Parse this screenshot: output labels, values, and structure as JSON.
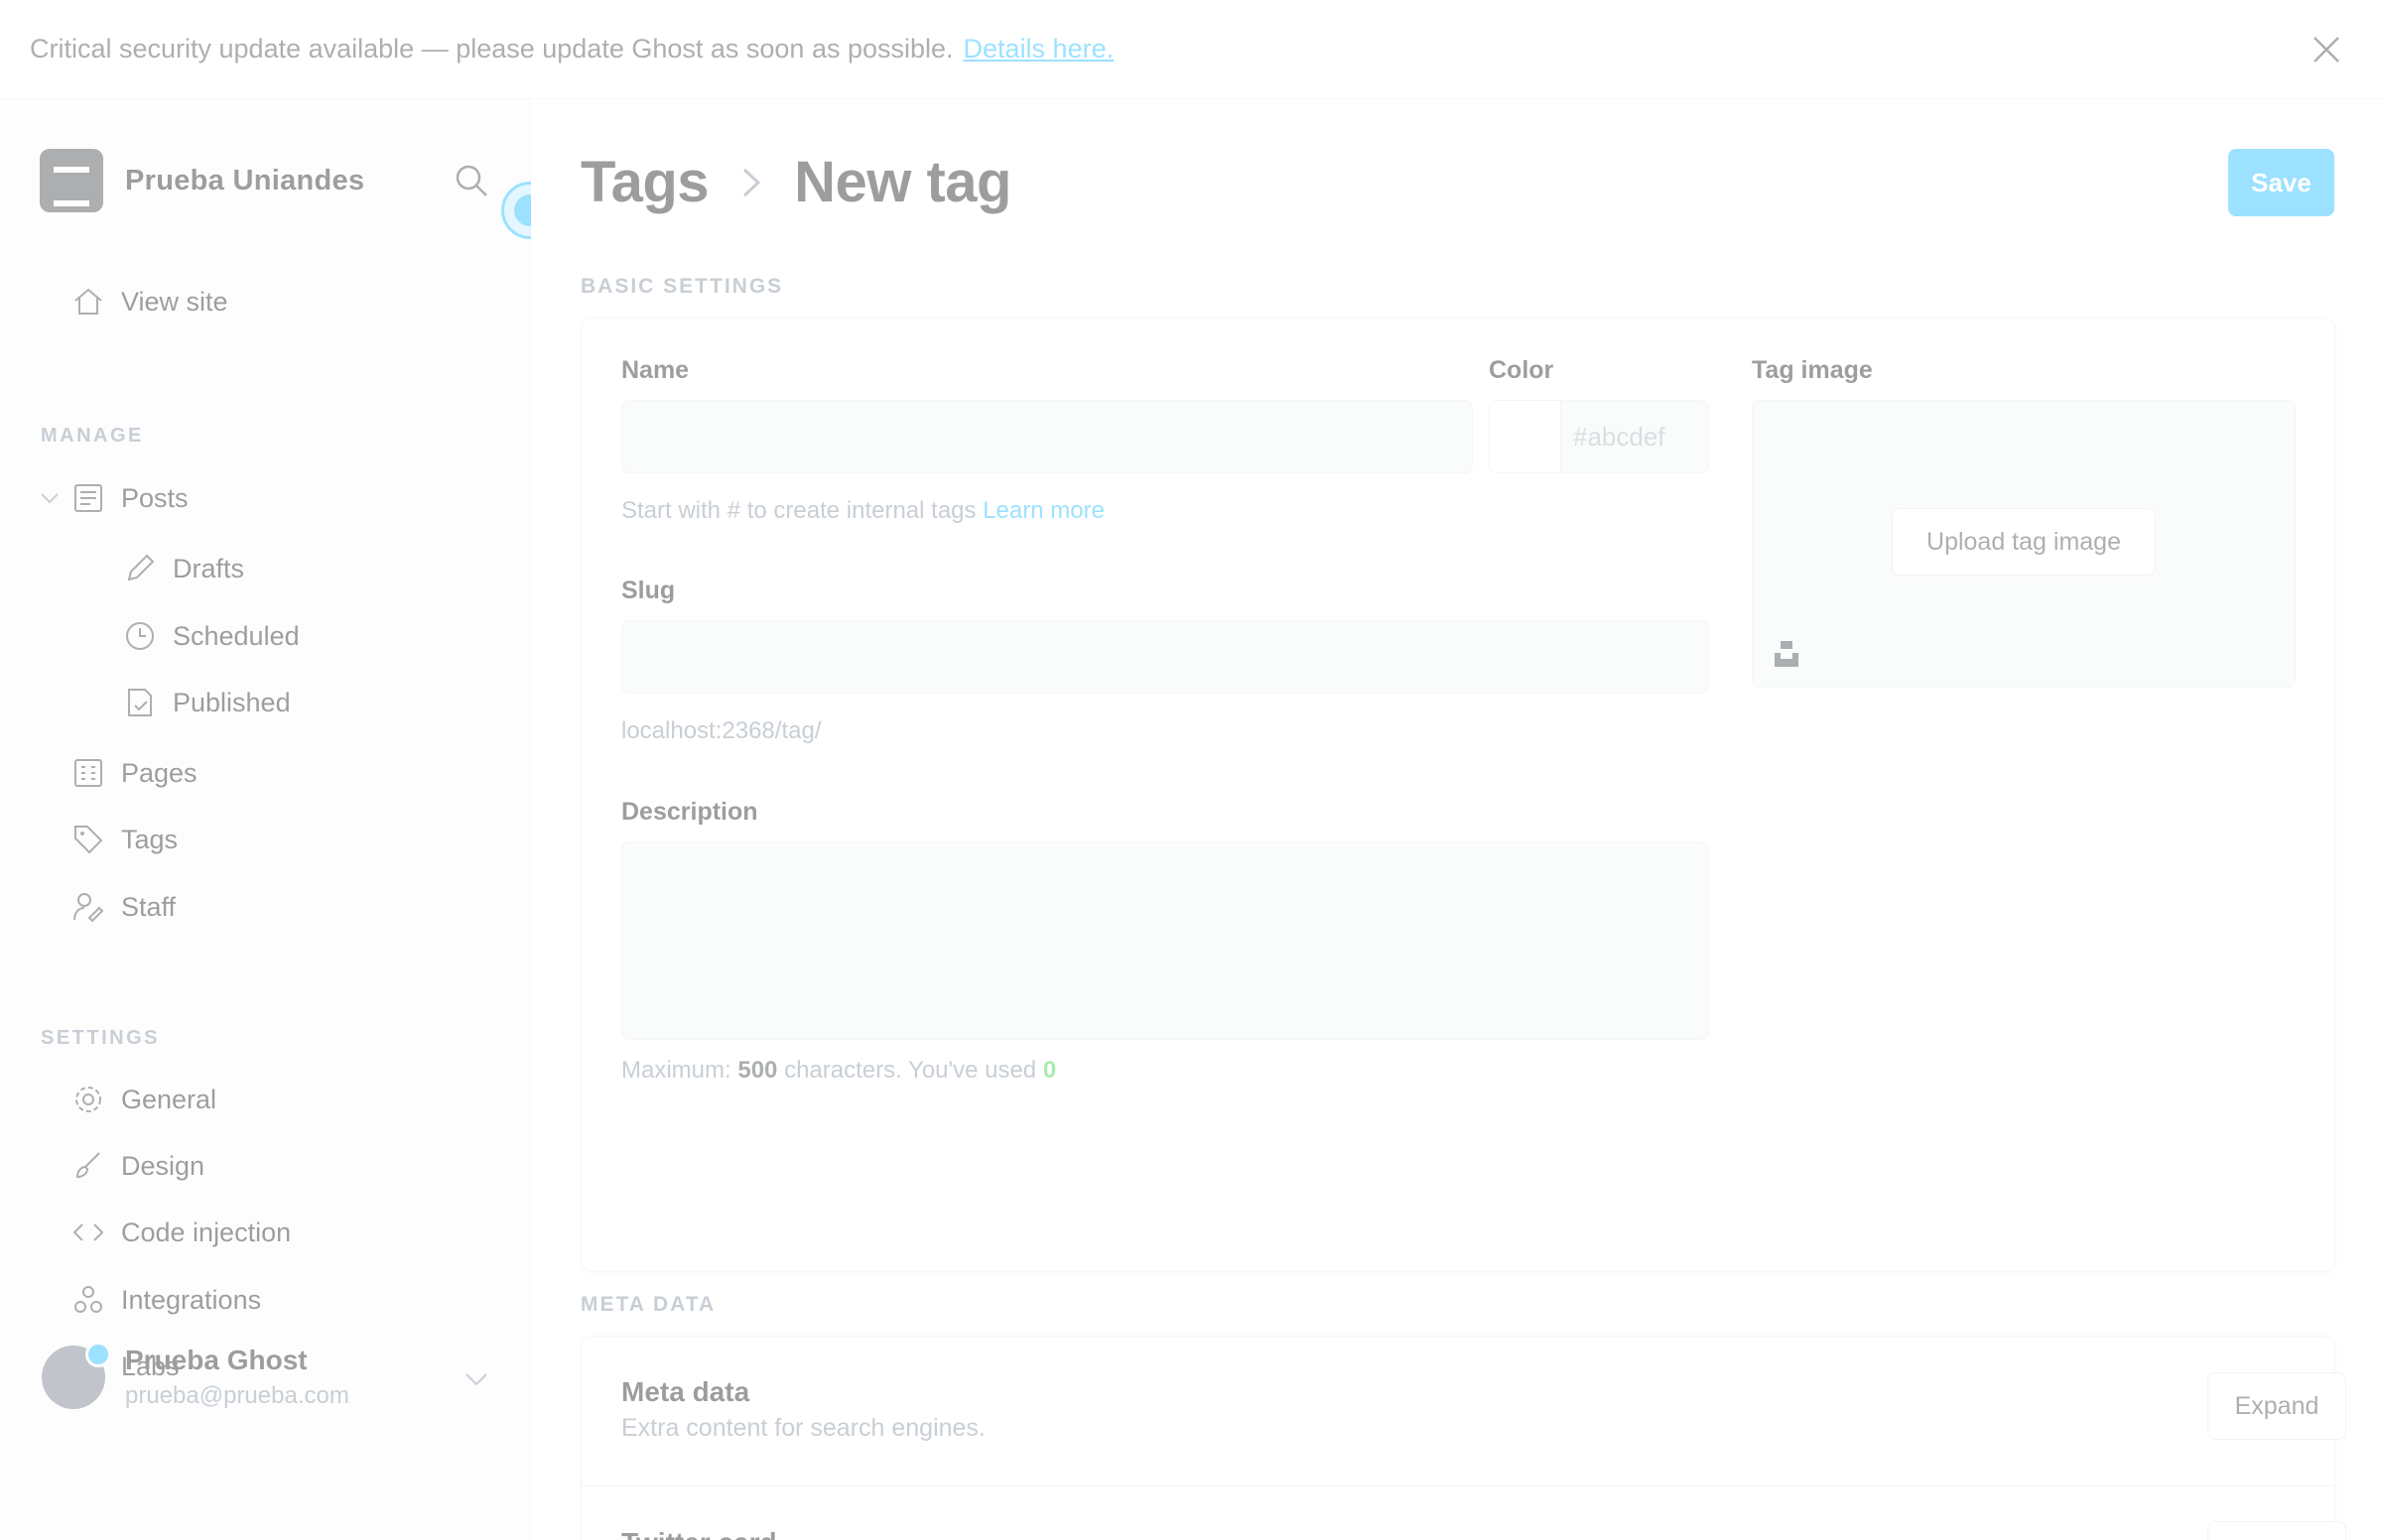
{
  "banner": {
    "text": "Critical security update available — please update Ghost as soon as possible.",
    "link": "Details here."
  },
  "sidebar": {
    "site_name": "Prueba Uniandes",
    "view_site": "View site",
    "manage_label": "MANAGE",
    "manage_items": {
      "posts": "Posts",
      "drafts": "Drafts",
      "scheduled": "Scheduled",
      "published": "Published",
      "pages": "Pages",
      "tags": "Tags",
      "staff": "Staff"
    },
    "settings_label": "SETTINGS",
    "settings_items": {
      "general": "General",
      "design": "Design",
      "code_injection": "Code injection",
      "integrations": "Integrations",
      "labs": "Labs"
    },
    "user": {
      "name": "Prueba Ghost",
      "email": "prueba@prueba.com"
    }
  },
  "header": {
    "parent": "Tags",
    "current": "New tag",
    "save_label": "Save"
  },
  "basic_settings": {
    "section_label": "BASIC SETTINGS",
    "name_label": "Name",
    "name_value": "",
    "name_hint": "Start with # to create internal tags",
    "name_hint_link": "Learn more",
    "color_label": "Color",
    "color_placeholder": "#abcdef",
    "tag_image_label": "Tag image",
    "upload_label": "Upload tag image",
    "slug_label": "Slug",
    "slug_value": "",
    "slug_url": "localhost:2368/tag/",
    "description_label": "Description",
    "description_value": "",
    "desc_hint_prefix": "Maximum:",
    "desc_hint_max": "500",
    "desc_hint_mid": "characters. You've used",
    "desc_hint_used": "0"
  },
  "meta": {
    "section_label": "META DATA",
    "title": "Meta data",
    "subtitle": "Extra content for search engines.",
    "expand_label": "Expand",
    "next_title": "Twitter card"
  },
  "colors": {
    "accent": "#14b8ff",
    "count_green": "#30cf43"
  }
}
